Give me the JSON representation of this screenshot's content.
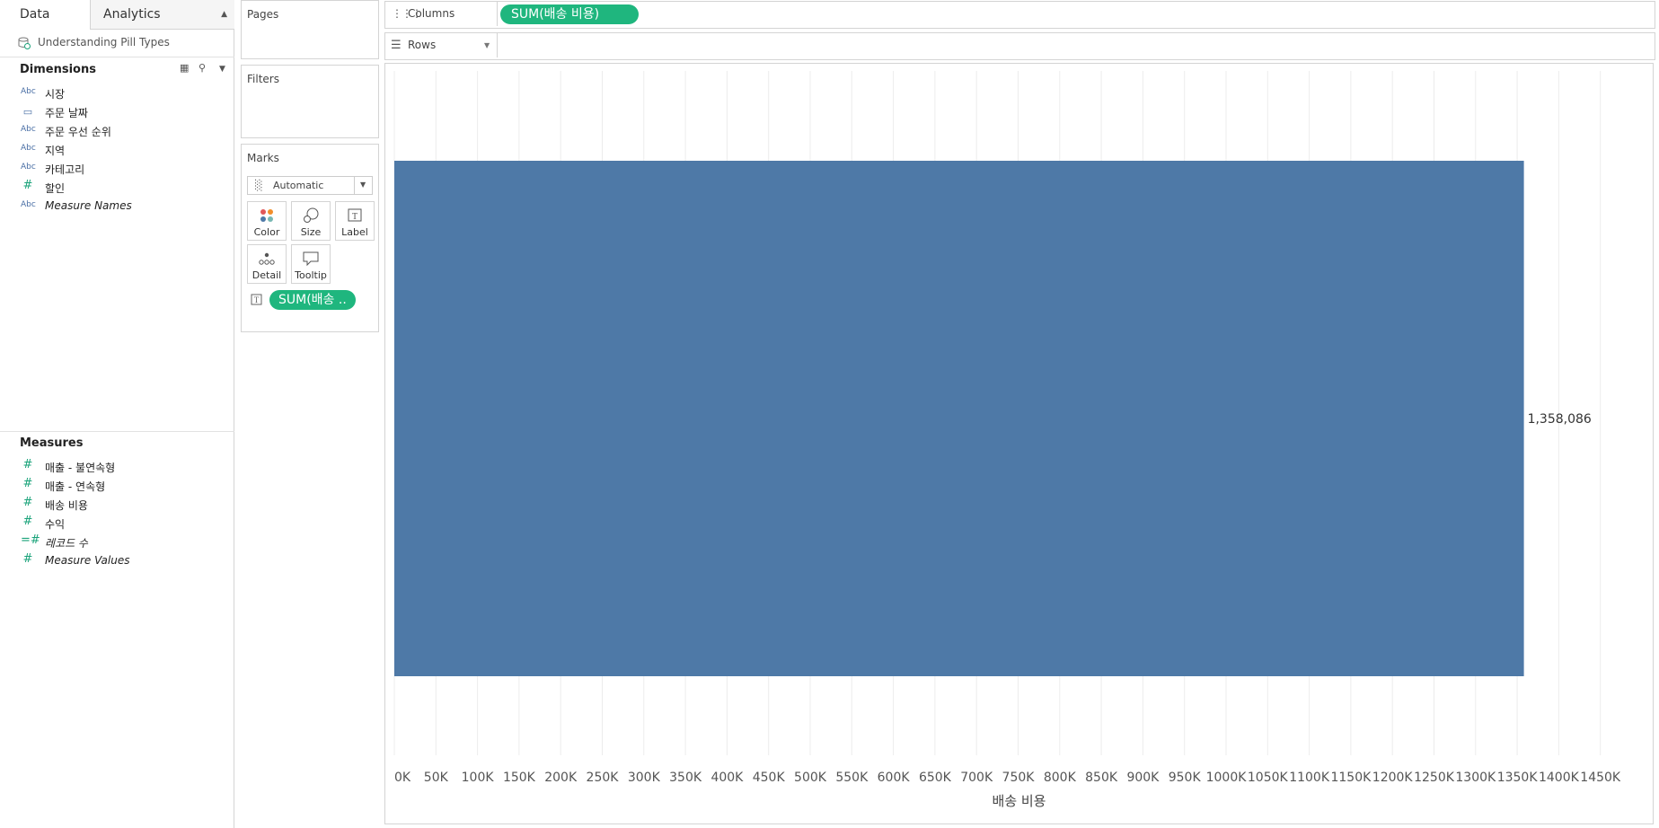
{
  "tabs": {
    "data": "Data",
    "analytics": "Analytics"
  },
  "datasource": {
    "name": "Understanding Pill Types"
  },
  "dimensions": {
    "title": "Dimensions",
    "items": [
      {
        "type": "Abc",
        "name": "시장",
        "italic": false
      },
      {
        "type": "cal",
        "name": "주문 날짜",
        "italic": false
      },
      {
        "type": "Abc",
        "name": "주문 우선 순위",
        "italic": false
      },
      {
        "type": "Abc",
        "name": "지역",
        "italic": false
      },
      {
        "type": "Abc",
        "name": "카테고리",
        "italic": false
      },
      {
        "type": "#",
        "name": "할인",
        "italic": false
      },
      {
        "type": "Abc",
        "name": "Measure Names",
        "italic": true
      }
    ]
  },
  "measures": {
    "title": "Measures",
    "items": [
      {
        "type": "#",
        "name": "매출 - 불연속형",
        "italic": false
      },
      {
        "type": "#",
        "name": "매출 - 연속형",
        "italic": false
      },
      {
        "type": "#",
        "name": "배송 비용",
        "italic": false
      },
      {
        "type": "#",
        "name": "수익",
        "italic": false
      },
      {
        "type": "=#",
        "name": "레코드 수",
        "italic": true
      },
      {
        "type": "#",
        "name": "Measure Values",
        "italic": true
      }
    ]
  },
  "pages_card": {
    "title": "Pages"
  },
  "filters_card": {
    "title": "Filters"
  },
  "marks_card": {
    "title": "Marks",
    "mark_type": "Automatic",
    "buttons": [
      "Color",
      "Size",
      "Label",
      "Detail",
      "Tooltip"
    ],
    "label_pill": "SUM(배송 .."
  },
  "columns_shelf": {
    "label": "Columns",
    "pill": "SUM(배송 비용)"
  },
  "rows_shelf": {
    "label": "Rows"
  },
  "chart_data": {
    "type": "bar",
    "orientation": "horizontal",
    "categories": [
      ""
    ],
    "values": [
      1358086
    ],
    "data_label": "1,358,086",
    "xlabel": "배송 비용",
    "xlim": [
      0,
      1500000
    ],
    "tick_values": [
      0,
      50000,
      100000,
      150000,
      200000,
      250000,
      300000,
      350000,
      400000,
      450000,
      500000,
      550000,
      600000,
      650000,
      700000,
      750000,
      800000,
      850000,
      900000,
      950000,
      1000000,
      1050000,
      1100000,
      1150000,
      1200000,
      1250000,
      1300000,
      1350000,
      1400000,
      1450000
    ],
    "tick_labels": [
      "0K",
      "50K",
      "100K",
      "150K",
      "200K",
      "250K",
      "300K",
      "350K",
      "400K",
      "450K",
      "500K",
      "550K",
      "600K",
      "650K",
      "700K",
      "750K",
      "800K",
      "850K",
      "900K",
      "950K",
      "1000K",
      "1050K",
      "1100K",
      "1150K",
      "1200K",
      "1250K",
      "1300K",
      "1350K",
      "1400K",
      "1450K"
    ],
    "bar_color": "#4e79a7",
    "grid": true
  }
}
